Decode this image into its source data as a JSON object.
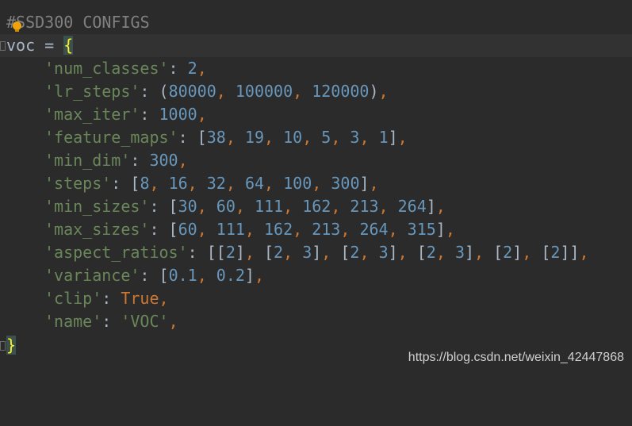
{
  "editor": {
    "comment_hash": "#",
    "comment_text": "SSD300 CONFIGS",
    "var_name": "voc",
    "assign": " = ",
    "open_brace": "{",
    "close_brace": "}",
    "entries": [
      {
        "key": "'num_classes'",
        "value_type": "num",
        "value": "2"
      },
      {
        "key": "'lr_steps'",
        "value_type": "tuple",
        "items": [
          "80000",
          "100000",
          "120000"
        ]
      },
      {
        "key": "'max_iter'",
        "value_type": "num",
        "value": "1000"
      },
      {
        "key": "'feature_maps'",
        "value_type": "list",
        "items": [
          "38",
          "19",
          "10",
          "5",
          "3",
          "1"
        ]
      },
      {
        "key": "'min_dim'",
        "value_type": "num",
        "value": "300"
      },
      {
        "key": "'steps'",
        "value_type": "list",
        "items": [
          "8",
          "16",
          "32",
          "64",
          "100",
          "300"
        ]
      },
      {
        "key": "'min_sizes'",
        "value_type": "list",
        "items": [
          "30",
          "60",
          "111",
          "162",
          "213",
          "264"
        ]
      },
      {
        "key": "'max_sizes'",
        "value_type": "list",
        "items": [
          "60",
          "111",
          "162",
          "213",
          "264",
          "315"
        ]
      },
      {
        "key": "'aspect_ratios'",
        "value_type": "nested",
        "groups": [
          [
            "2"
          ],
          [
            "2",
            "3"
          ],
          [
            "2",
            "3"
          ],
          [
            "2",
            "3"
          ],
          [
            "2"
          ],
          [
            "2"
          ]
        ]
      },
      {
        "key": "'variance'",
        "value_type": "list",
        "items": [
          "0.1",
          "0.2"
        ]
      },
      {
        "key": "'clip'",
        "value_type": "kw",
        "value": "True"
      },
      {
        "key": "'name'",
        "value_type": "str",
        "value": "'VOC'"
      }
    ]
  },
  "watermark": "https://blog.csdn.net/weixin_42447868",
  "colors": {
    "background": "#2b2b2b",
    "string": "#6a8759",
    "number": "#6897bb",
    "keyword": "#cc7832",
    "comment": "#808080"
  }
}
